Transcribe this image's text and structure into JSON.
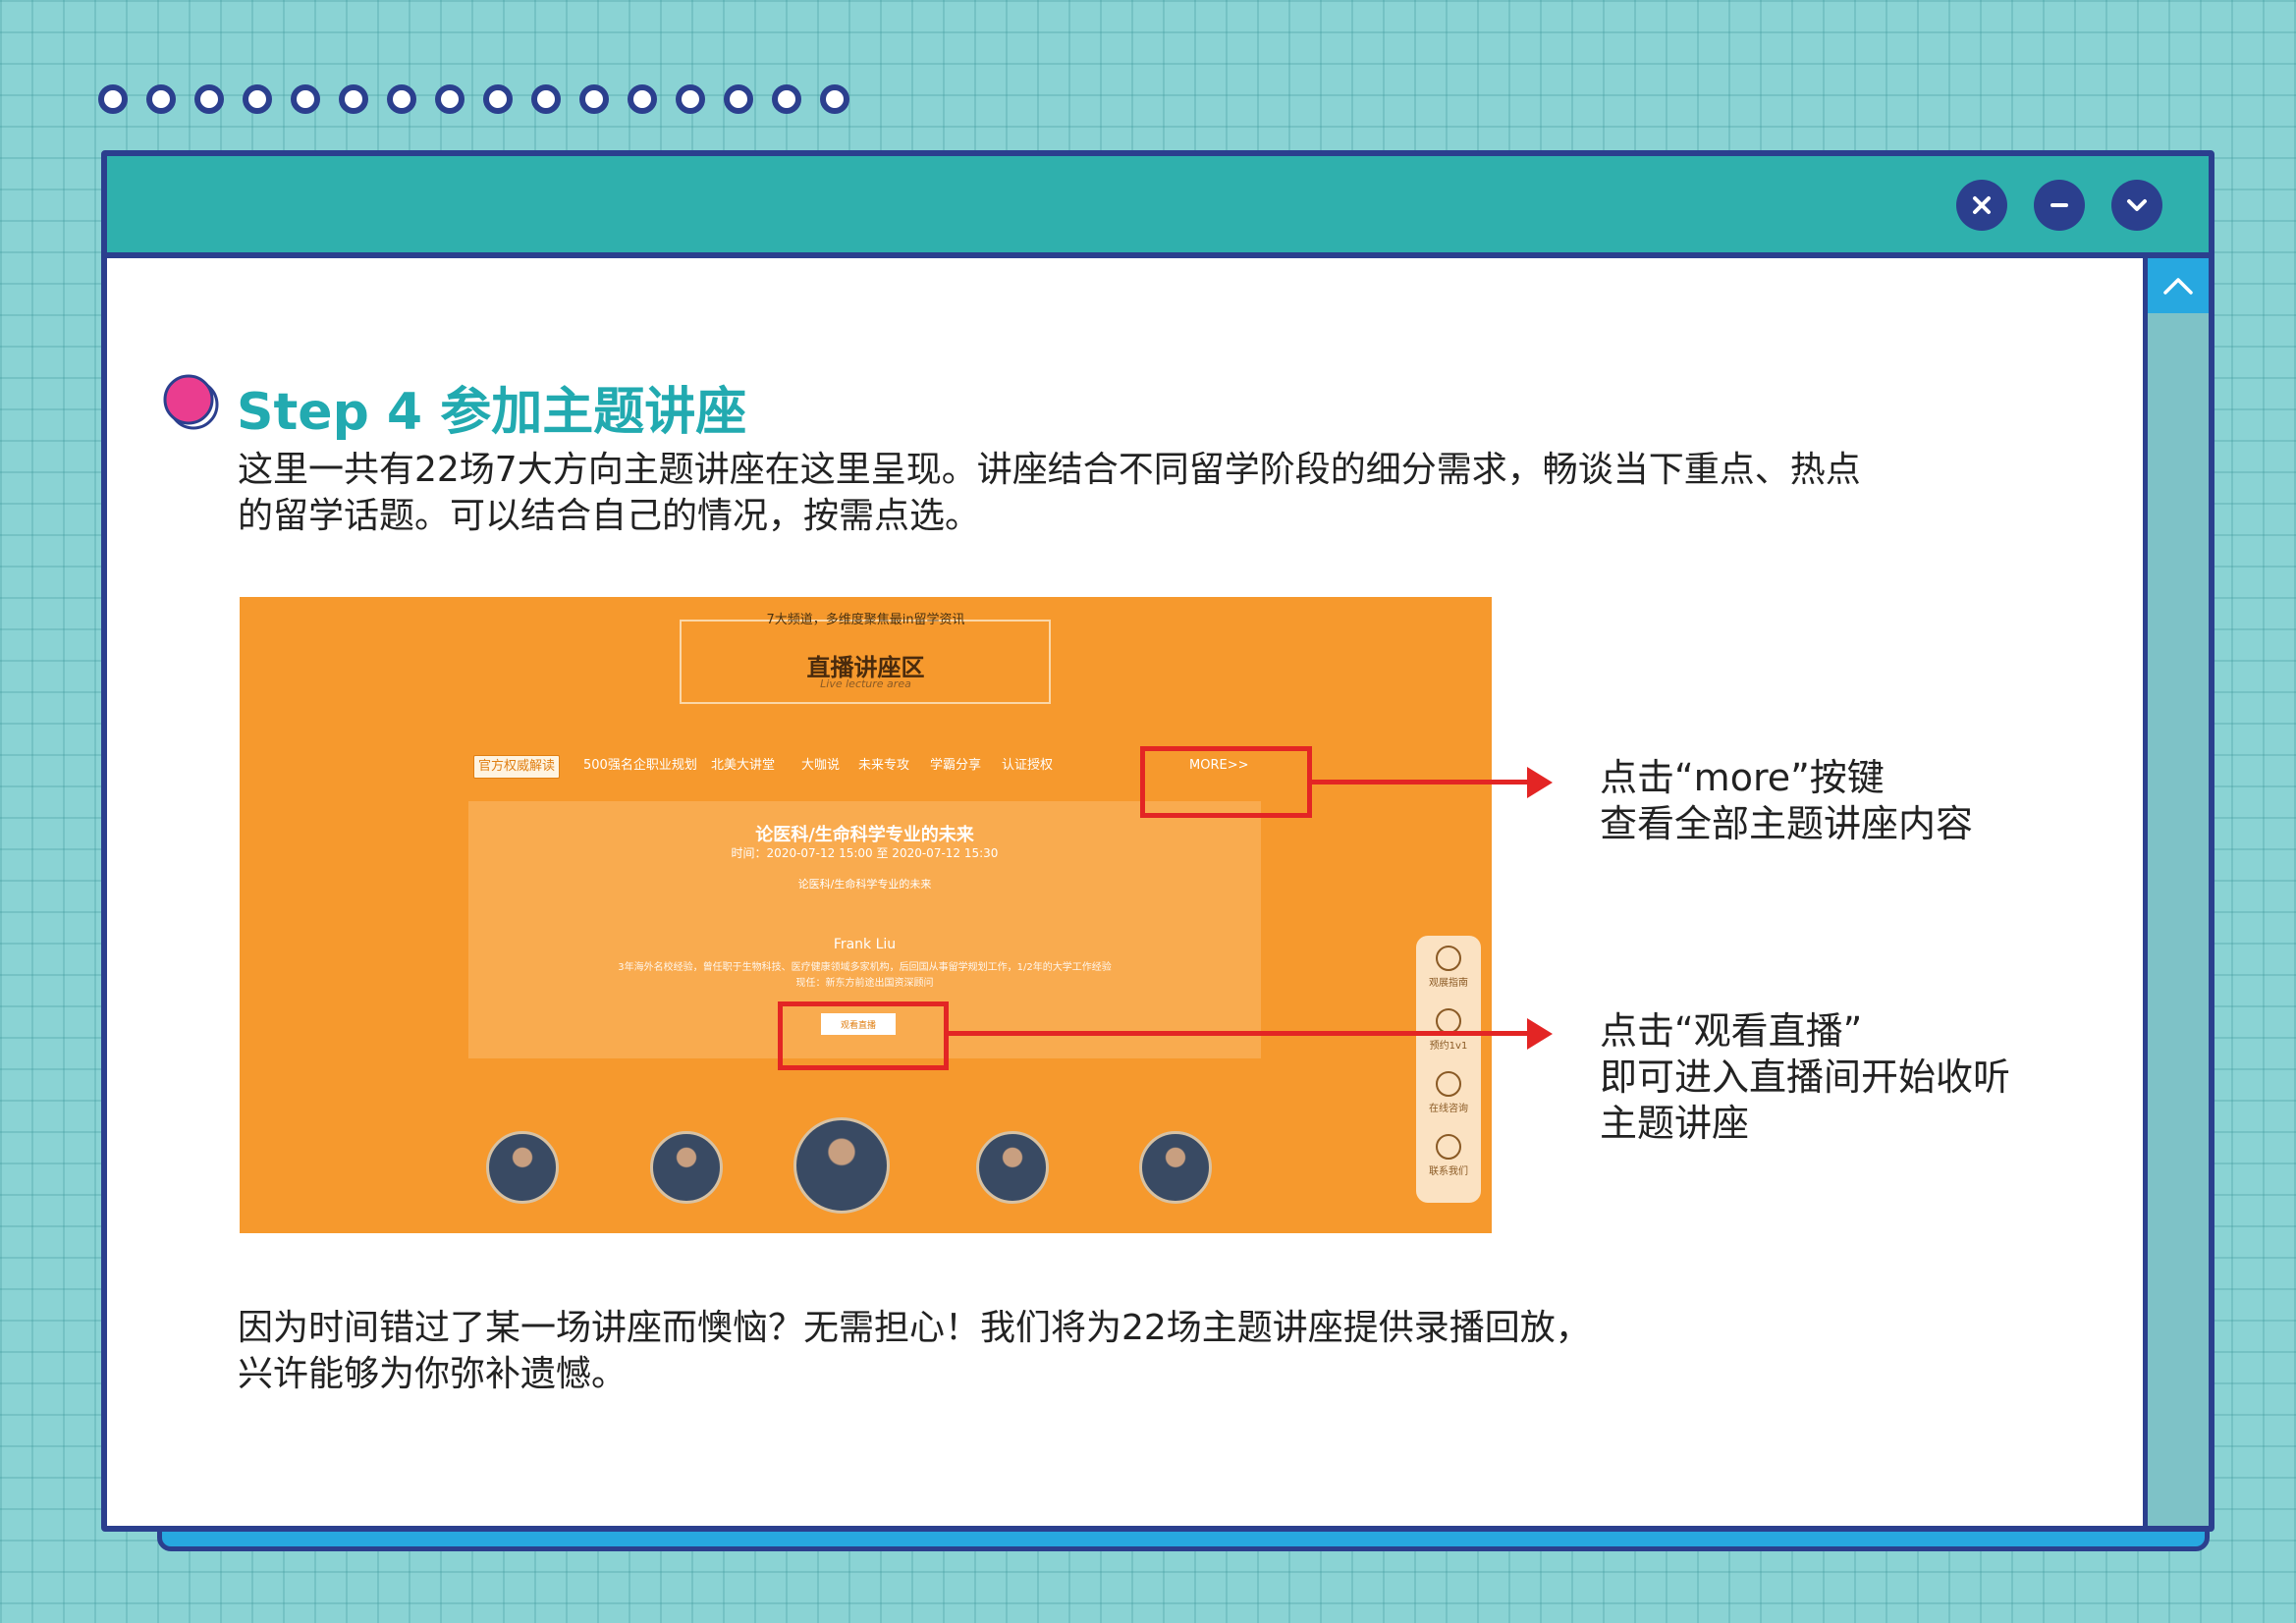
{
  "colors": {
    "background": "#8ad3d4",
    "window_border": "#2b3f8e",
    "titlebar": "#2fb0ad",
    "accent_teal": "#22aab0",
    "highlight_red": "#e32524",
    "screenshot_orange": "#f6992d"
  },
  "window": {
    "buttons": [
      {
        "icon": "close-icon",
        "glyph": "✕"
      },
      {
        "icon": "minimize-icon",
        "glyph": "−"
      },
      {
        "icon": "chevron-down-icon",
        "glyph": "⌄"
      }
    ],
    "scroll_up_icon": "chevron-up-icon"
  },
  "step": {
    "title": "Step 4 参加主题讲座",
    "intro_line1": "这里一共有22场7大方向主题讲座在这里呈现。讲座结合不同留学阶段的细分需求，畅谈当下重点、热点",
    "intro_line2": "的留学话题。可以结合自己的情况，按需点选。",
    "note_line1": "因为时间错过了某一场讲座而懊恼？无需担心！我们将为22场主题讲座提供录播回放，",
    "note_line2": "兴许能够为你弥补遗憾。"
  },
  "screenshot": {
    "subtitle": "7大频道，多维度聚焦最in留学资讯",
    "title": "直播讲座区",
    "title_en": "Live lecture area",
    "tabs": [
      "官方权威解读",
      "500强名企职业规划",
      "北美大讲堂",
      "大咖说",
      "未来专攻",
      "学霸分享",
      "认证授权"
    ],
    "more": "MORE>>",
    "lecture_title": "论医科/生命科学专业的未来",
    "lecture_time": "时间：2020-07-12 15:00 至 2020-07-12 15:30",
    "lecture_desc": "论医科/生命科学专业的未来",
    "speaker": "Frank Liu",
    "speaker_bio_line1": "3年海外名校经验，曾任职于生物科技、医疗健康领域多家机构，后回国从事留学规划工作，1/2年的大学工作经验",
    "speaker_bio_line2": "现任：新东方前途出国资深顾问",
    "watch_button": "观看直播",
    "sidebar": [
      "观展指南",
      "预约1v1",
      "在线咨询",
      "联系我们"
    ]
  },
  "annotations": {
    "more_line1": "点击“more”按键",
    "more_line2": "查看全部主题讲座内容",
    "watch_line1": "点击“观看直播”",
    "watch_line2": "即可进入直播间开始收听",
    "watch_line3": "主题讲座"
  }
}
